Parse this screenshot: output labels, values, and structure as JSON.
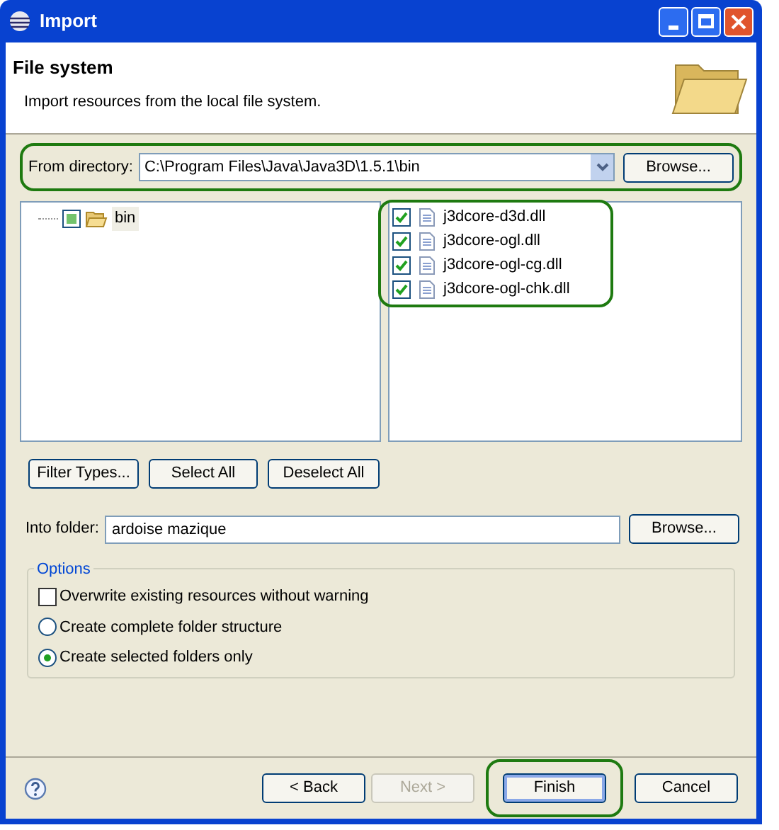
{
  "window": {
    "title": "Import"
  },
  "header": {
    "title": "File system",
    "description": "Import resources from the local file system."
  },
  "from_directory": {
    "label": "From directory:",
    "value": "C:\\Program Files\\Java\\Java3D\\1.5.1\\bin",
    "button": "Browse..."
  },
  "folder_tree": [
    {
      "label": "bin",
      "checked": true,
      "grayed": true
    }
  ],
  "files": [
    {
      "label": "j3dcore-d3d.dll",
      "checked": true
    },
    {
      "label": "j3dcore-ogl.dll",
      "checked": true
    },
    {
      "label": "j3dcore-ogl-cg.dll",
      "checked": true
    },
    {
      "label": "j3dcore-ogl-chk.dll",
      "checked": true
    }
  ],
  "selection_buttons": [
    "Filter Types...",
    "Select All",
    "Deselect All"
  ],
  "into_folder": {
    "label": "Into folder:",
    "value": "ardoise mazique",
    "button": "Browse..."
  },
  "options": {
    "title": "Options",
    "items": [
      {
        "kind": "checkbox",
        "label": "Overwrite existing resources without warning",
        "checked": false
      },
      {
        "kind": "radio",
        "label": "Create complete folder structure",
        "selected": false
      },
      {
        "kind": "radio",
        "label": "Create selected folders only",
        "selected": true
      }
    ]
  },
  "footer_buttons": [
    {
      "label": "< Back",
      "disabled": false,
      "default": false
    },
    {
      "label": "Next >",
      "disabled": true,
      "default": false
    },
    {
      "label": "Finish",
      "disabled": false,
      "default": true
    },
    {
      "label": "Cancel",
      "disabled": false,
      "default": false
    }
  ]
}
